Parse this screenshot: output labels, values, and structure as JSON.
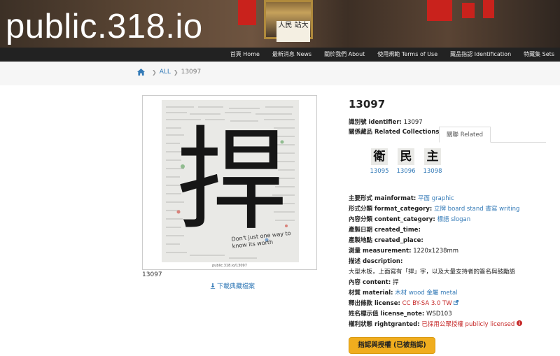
{
  "site": {
    "title": "public.318.io",
    "banner_sign": "人民 站大"
  },
  "nav": [
    {
      "label": "首頁 Home"
    },
    {
      "label": "最新消息 News"
    },
    {
      "label": "關於我們 About"
    },
    {
      "label": "使用規範 Terms of Use"
    },
    {
      "label": "藏品指認 Identification"
    },
    {
      "label": "特藏集 Sets"
    }
  ],
  "breadcrumb": {
    "home_icon": "home-icon",
    "all": "ALL",
    "current": "13097"
  },
  "image": {
    "big_char": "捍",
    "handwriting": "Don't just one way to know its worth",
    "url_label": "public.318.io/13097",
    "caption": "13097",
    "download_label": "下載典藏檔案"
  },
  "record": {
    "title": "13097",
    "identifier_label": "識別號 identifier:",
    "identifier_value": "13097",
    "related_label": "關係藏品 Related Collections:",
    "related_tab": "關聯 Related",
    "related_items": [
      {
        "char": "衛",
        "id": "13095"
      },
      {
        "char": "民",
        "id": "13096"
      },
      {
        "char": "主",
        "id": "13098"
      }
    ],
    "mainformat_label": "主要形式 mainformat:",
    "mainformat_value": "平面 graphic",
    "format_category_label": "形式分類 format_category:",
    "format_category_values": [
      "立牌 board stand",
      "書寫 writing"
    ],
    "content_category_label": "內容分類 content_category:",
    "content_category_value": "標語 slogan",
    "created_time_label": "產製日期 created_time:",
    "created_place_label": "產製地點 created_place:",
    "measurement_label": "測量 measurement:",
    "measurement_value": "1220x1238mm",
    "description_label": "描述 description:",
    "description_value": "大型木板，上面寫有「捍」字，以及大量支持者的簽名與鼓勵語",
    "content_label": "內容 content:",
    "content_value": "捍",
    "material_label": "材質 material:",
    "material_values": [
      "木材 wood",
      "金屬 metal"
    ],
    "license_label": "釋出條款 license:",
    "license_value": "CC BY-SA 3.0 TW",
    "license_note_label": "姓名標示值 license_note:",
    "license_note_value": "WSD103",
    "rightgranted_label": "權利狀態 rightgranted:",
    "rightgranted_value": "已採用公眾授權 publicly licensed",
    "claim_button": "指認與授權 (已被指認)"
  },
  "colors": {
    "link": "#337ab7",
    "nav_bg": "#222222",
    "button": "#f0ad1e",
    "license_red": "#c62828"
  }
}
